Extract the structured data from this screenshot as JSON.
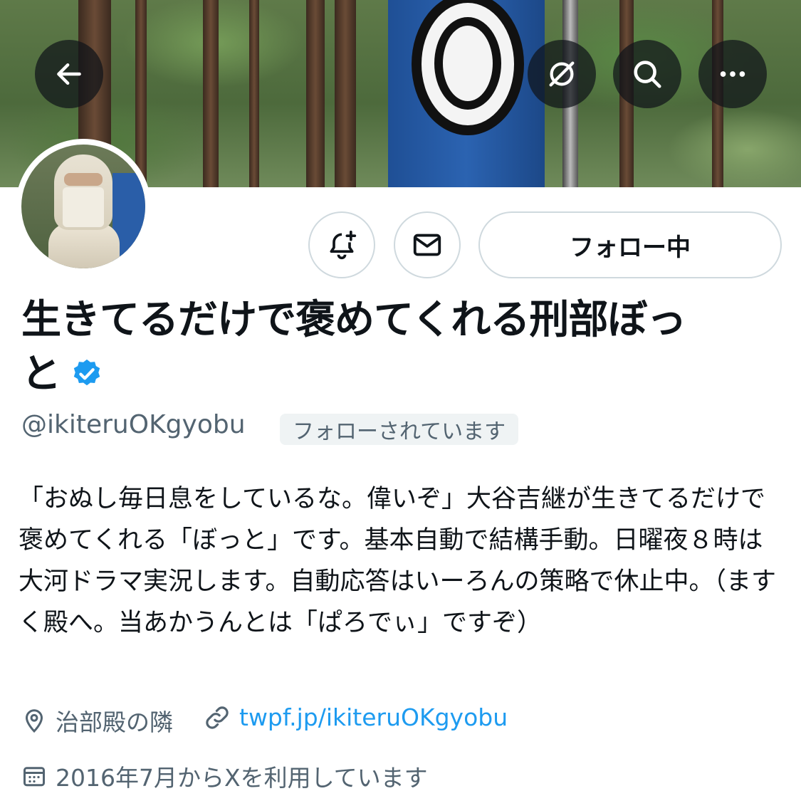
{
  "header": {
    "back_icon": "back-arrow-icon",
    "grok_icon": "grok-icon",
    "search_icon": "search-icon",
    "more_icon": "more-icon"
  },
  "actions": {
    "notify_icon": "bell-plus-icon",
    "message_icon": "mail-icon",
    "follow_label": "フォロー中"
  },
  "profile": {
    "name_line1": "生きてるだけで褒めてくれる刑部ぼっ",
    "name_line2": "と",
    "verified": true,
    "handle": "@ikiteruOKgyobu",
    "follows_you": "フォローされています",
    "bio": "「おぬし毎日息をしているな。偉いぞ」大谷吉継が生きてるだけで褒めてくれる「ぼっと」です。基本自動で結構手動。日曜夜８時は大河ドラマ実況します。自動応答はいーろんの策略で休止中。（ますく殿へ。当あかうんとは「ぱろでぃ」ですぞ）",
    "location": "治部殿の隣",
    "website": "twpf.jp/ikiteruOKgyobu",
    "joined": "2016年7月からXを利用しています"
  },
  "colors": {
    "verified_blue": "#1d9bf0",
    "secondary_text": "#536471",
    "border": "#cfd9de"
  }
}
